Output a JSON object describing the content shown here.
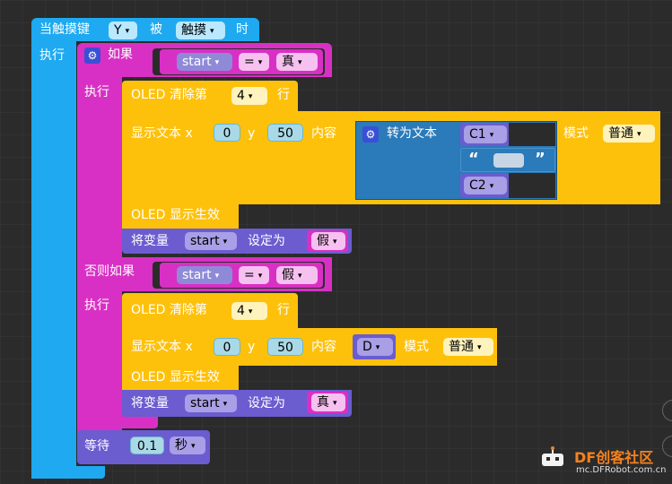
{
  "event": {
    "prefix": "当触摸键",
    "key": "Y",
    "mid": "被",
    "action": "触摸",
    "suffix": "时"
  },
  "exec_label": "执行",
  "if_block": {
    "if_label": "如果",
    "cond_var": "start",
    "op": "=",
    "value": "真",
    "then_label": "执行",
    "clear": {
      "label": "OLED 清除第",
      "row": "4",
      "unit": "行"
    },
    "show": {
      "label": "显示文本 x",
      "x": "0",
      "y_label": "y",
      "y": "50",
      "content_label": "内容",
      "to_text_label": "转为文本",
      "item1": "C1",
      "quote_open": "“",
      "quote_close": "”",
      "item2": "C2",
      "mode_label": "模式",
      "mode": "普通"
    },
    "oled_show": "OLED 显示生效",
    "set_var": {
      "label": "将变量",
      "var": "start",
      "to": "设定为",
      "value": "假"
    },
    "elseif_label": "否则如果",
    "cond2_var": "start",
    "op2": "=",
    "value2": "假",
    "then2_label": "执行",
    "clear2": {
      "label": "OLED 清除第",
      "row": "4",
      "unit": "行"
    },
    "show2": {
      "label": "显示文本 x",
      "x": "0",
      "y_label": "y",
      "y": "50",
      "content_label": "内容",
      "content": "D",
      "mode_label": "模式",
      "mode": "普通"
    },
    "oled_show2": "OLED 显示生效",
    "set_var2": {
      "label": "将变量",
      "var": "start",
      "to": "设定为",
      "value": "真"
    }
  },
  "wait": {
    "label": "等待",
    "value": "0.1",
    "unit": "秒"
  },
  "watermark": {
    "brand": "DF创客社区",
    "url": "mc.DFRobot.com.cn"
  },
  "colors": {
    "event": "#1ea9f0",
    "logic": "#d830c4",
    "oled": "#fec10b",
    "text": "#2b7ab9",
    "var": "#6b5cd0",
    "number": "#9ad7e6"
  }
}
